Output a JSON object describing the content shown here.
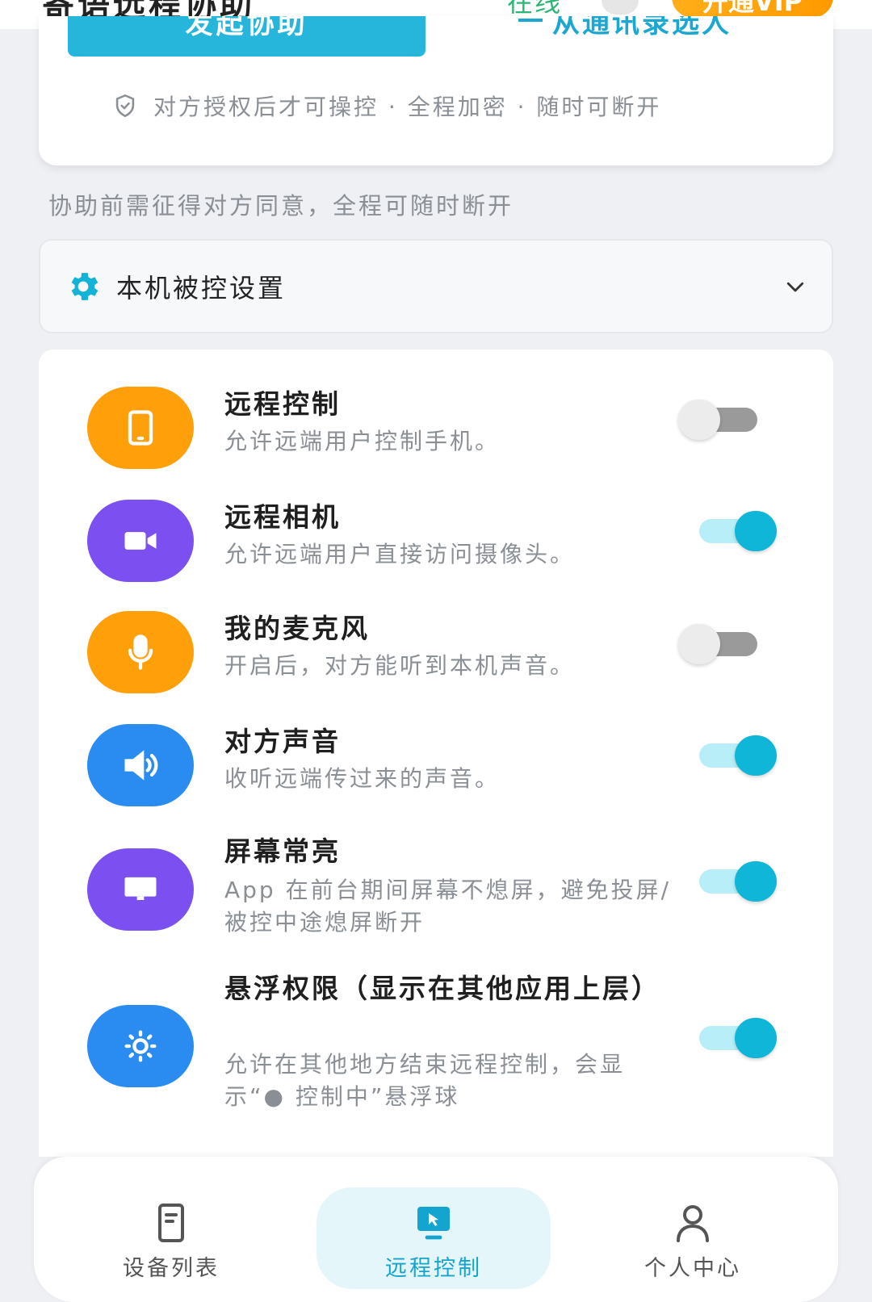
{
  "header": {
    "title": "寄语远程协助",
    "status": "在线",
    "vip_button": "开通VIP"
  },
  "connect_card": {
    "start_button": "发起协助",
    "history_link": "从通讯录选人",
    "secure_note": "对方授权后才可操控 · 全程加密 · 随时可断开"
  },
  "consent_hint": "协助前需征得对方同意，全程可随时断开",
  "settings": {
    "title": "本机被控设置"
  },
  "permissions": [
    {
      "title": "远程控制",
      "desc": "允许远端用户控制手机。",
      "enabled": false,
      "icon": "tablet-icon",
      "color": "#ff9f0a"
    },
    {
      "title": "远程相机",
      "desc": "允许远端用户直接访问摄像头。",
      "enabled": true,
      "icon": "video-camera-icon",
      "color": "#7b4ff0"
    },
    {
      "title": "我的麦克风",
      "desc": "开启后，对方能听到本机声音。",
      "enabled": false,
      "icon": "microphone-icon",
      "color": "#ff9f0a"
    },
    {
      "title": "对方声音",
      "desc": "收听远端传过来的声音。",
      "enabled": true,
      "icon": "speaker-icon",
      "color": "#2a8cf0"
    },
    {
      "title": "屏幕常亮",
      "desc": "App 在前台期间屏幕不熄屏，避免投屏/被控中途熄屏断开",
      "enabled": true,
      "icon": "monitor-icon",
      "color": "#7b4ff0"
    },
    {
      "title": "悬浮权限（显示在其他应用上层）",
      "desc": "允许在其他地方结束远程控制，会显示“● 控制中”悬浮球",
      "enabled": true,
      "icon": "brightness-icon",
      "color": "#2a8cf0"
    }
  ],
  "bottom_nav": {
    "tabs": [
      {
        "label": "设备列表",
        "icon": "device-list-icon",
        "active": false
      },
      {
        "label": "远程控制",
        "icon": "remote-control-icon",
        "active": true
      },
      {
        "label": "个人中心",
        "icon": "person-icon",
        "active": false
      }
    ]
  },
  "colors": {
    "accent": "#10b6d8",
    "orange": "#ff9f0a",
    "purple": "#7b4ff0",
    "blue": "#2a8cf0"
  }
}
